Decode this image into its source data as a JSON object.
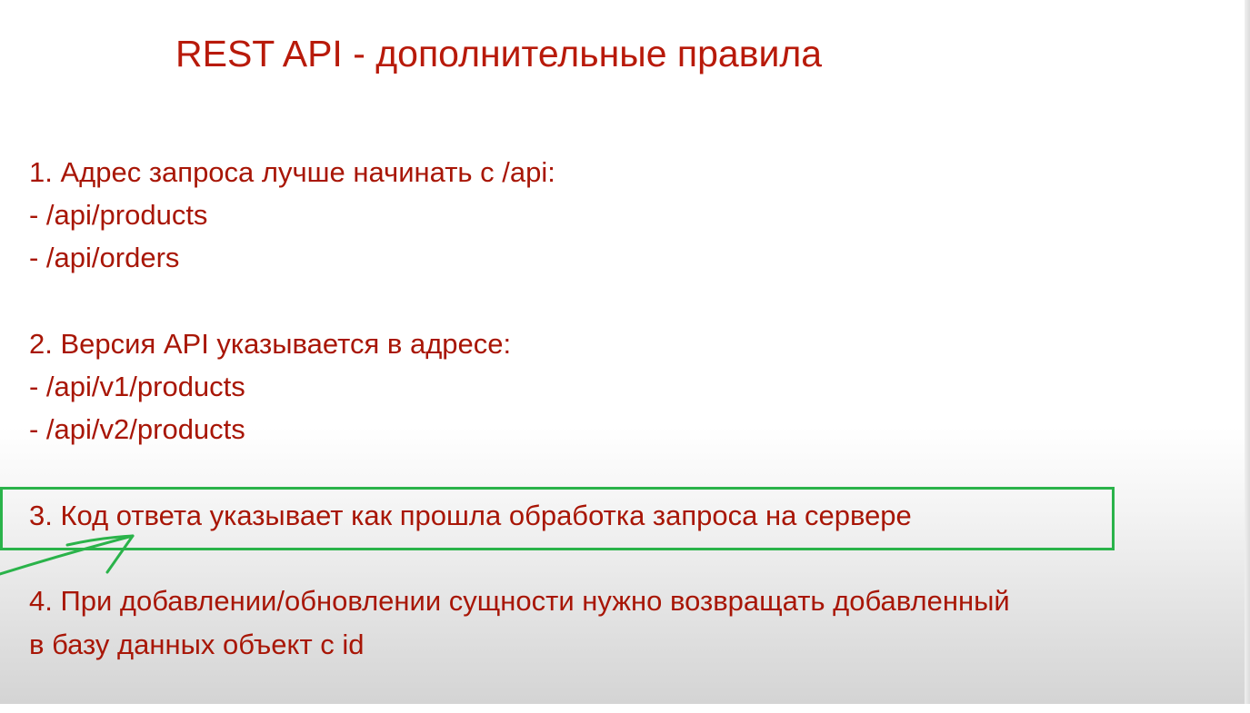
{
  "slide": {
    "title": "REST API - дополнительные правила",
    "rules": [
      {
        "heading": "1. Адрес запроса лучше начинать с /api:",
        "items": [
          "- /api/products",
          "- /api/orders"
        ]
      },
      {
        "heading": "2. Версия API указывается в адресе:",
        "items": [
          "- /api/v1/products",
          "- /api/v2/products"
        ]
      },
      {
        "heading": "3. Код ответа указывает как прошла обработка запроса на сервере",
        "items": []
      },
      {
        "heading": "4. При добавлении/обновлении сущности нужно возвращать добавленный",
        "items": [
          "в базу данных объект с id"
        ]
      }
    ]
  },
  "colors": {
    "text": "#a81606",
    "title": "#b81a0a",
    "annotation": "#2ab34a"
  }
}
